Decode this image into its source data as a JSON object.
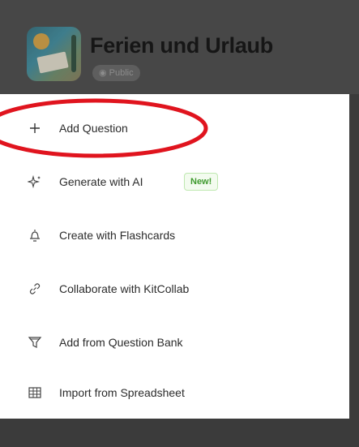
{
  "header": {
    "title": "Ferien und Urlaub",
    "visibility": "Public",
    "thumbnail_icon": "quiz-cover-image"
  },
  "menu": {
    "items": [
      {
        "label": "Add Question",
        "icon": "plus-icon"
      },
      {
        "label": "Generate with AI",
        "icon": "sparkles-icon",
        "badge": "New!"
      },
      {
        "label": "Create with Flashcards",
        "icon": "flashcards-icon"
      },
      {
        "label": "Collaborate with KitCollab",
        "icon": "link-icon"
      },
      {
        "label": "Add from Question Bank",
        "icon": "question-bank-icon"
      },
      {
        "label": "Import from Spreadsheet",
        "icon": "spreadsheet-icon"
      }
    ]
  },
  "colors": {
    "overlay": "#474747",
    "menu_bg": "#ffffff",
    "new_badge_text": "#3f9a2e",
    "annotation": "#e0141e"
  }
}
